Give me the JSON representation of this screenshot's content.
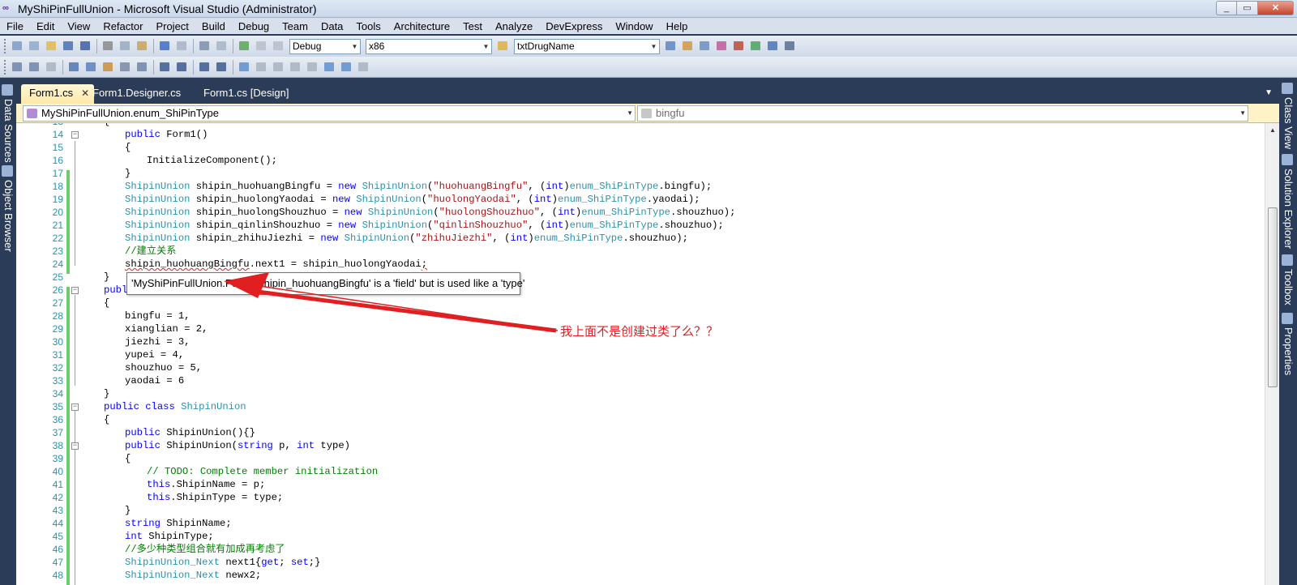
{
  "window": {
    "title": "MyShiPinFullUnion - Microsoft Visual Studio (Administrator)",
    "buttons": [
      "_",
      "▭",
      "✕"
    ]
  },
  "menu": [
    "File",
    "Edit",
    "View",
    "Refactor",
    "Project",
    "Build",
    "Debug",
    "Team",
    "Data",
    "Tools",
    "Architecture",
    "Test",
    "Analyze",
    "DevExpress",
    "Window",
    "Help"
  ],
  "toolbar": {
    "config": "Debug",
    "platform": "x86",
    "find": "txtDrugName"
  },
  "left_tabs": [
    "Data Sources",
    "Object Browser"
  ],
  "right_tabs": [
    "Class View",
    "Solution Explorer",
    "Toolbox",
    "Properties"
  ],
  "doc_tabs": [
    {
      "label": "Form1.cs",
      "active": true
    },
    {
      "label": "Form1.Designer.cs",
      "active": false
    },
    {
      "label": "Form1.cs [Design]",
      "active": false
    }
  ],
  "navbar": {
    "type": "MyShiPinFullUnion.enum_ShiPinType",
    "member": "bingfu"
  },
  "code_lines": [
    {
      "n": "13",
      "t": "{"
    },
    {
      "n": "14",
      "t": "public Form1()"
    },
    {
      "n": "15",
      "t": "{"
    },
    {
      "n": "16",
      "t": "InitializeComponent();"
    },
    {
      "n": "17",
      "t": "}"
    },
    {
      "n": "18",
      "t": "ShipinUnion shipin_huohuangBingfu = new ShipinUnion(\"huohuangBingfu\", (int)enum_ShiPinType.bingfu);"
    },
    {
      "n": "19",
      "t": "ShipinUnion shipin_huolongYaodai = new ShipinUnion(\"huolongYaodai\", (int)enum_ShiPinType.yaodai);"
    },
    {
      "n": "20",
      "t": "ShipinUnion shipin_huolongShouzhuo = new ShipinUnion(\"huolongShouzhuo\", (int)enum_ShiPinType.shouzhuo);"
    },
    {
      "n": "21",
      "t": "ShipinUnion shipin_qinlinShouzhuo = new ShipinUnion(\"qinlinShouzhuo\", (int)enum_ShiPinType.shouzhuo);"
    },
    {
      "n": "22",
      "t": "ShipinUnion shipin_zhihuJiezhi = new ShipinUnion(\"zhihuJiezhi\", (int)enum_ShiPinType.shouzhuo);"
    },
    {
      "n": "23",
      "t": "//建立关系"
    },
    {
      "n": "24",
      "t": "shipin_huohuangBingfu.next1 = shipin_huolongYaodai;"
    },
    {
      "n": "25",
      "t": "}"
    },
    {
      "n": "26",
      "t": "publ"
    },
    {
      "n": "27",
      "t": "{"
    },
    {
      "n": "28",
      "t": "bingfu = 1,"
    },
    {
      "n": "29",
      "t": "xianglian = 2,"
    },
    {
      "n": "30",
      "t": "jiezhi = 3,"
    },
    {
      "n": "31",
      "t": "yupei = 4,"
    },
    {
      "n": "32",
      "t": "shouzhuo = 5,"
    },
    {
      "n": "33",
      "t": "yaodai = 6"
    },
    {
      "n": "34",
      "t": "}"
    },
    {
      "n": "35",
      "t": "public class ShipinUnion"
    },
    {
      "n": "36",
      "t": "{"
    },
    {
      "n": "37",
      "t": "public ShipinUnion(){}"
    },
    {
      "n": "38",
      "t": "public ShipinUnion(string p, int type)"
    },
    {
      "n": "39",
      "t": "{"
    },
    {
      "n": "40",
      "t": "// TODO: Complete member initialization"
    },
    {
      "n": "41",
      "t": "this.ShipinName = p;"
    },
    {
      "n": "42",
      "t": "this.ShipinType = type;"
    },
    {
      "n": "43",
      "t": "}"
    },
    {
      "n": "44",
      "t": "string ShipinName;"
    },
    {
      "n": "45",
      "t": "int ShipinType;"
    },
    {
      "n": "46",
      "t": "//多少种类型组合就有加成再考虑了"
    },
    {
      "n": "47",
      "t": "ShipinUnion_Next next1{get; set;}"
    },
    {
      "n": "48",
      "t": "ShipinUnion_Next newx2;"
    }
  ],
  "tooltip": "'MyShiPinFullUnion.Form1.shipin_huohuangBingfu' is a 'field' but is used like a 'type'",
  "annotation": {
    "note": "我上面不是创建过类了么？？",
    "color": "#e02020"
  },
  "colors": {
    "keyword": "#0000ff",
    "type": "#2b91af",
    "string": "#a31515",
    "comment": "#008000",
    "ide_background": "#2b3c59",
    "active_tab": "#ffe8a6"
  }
}
